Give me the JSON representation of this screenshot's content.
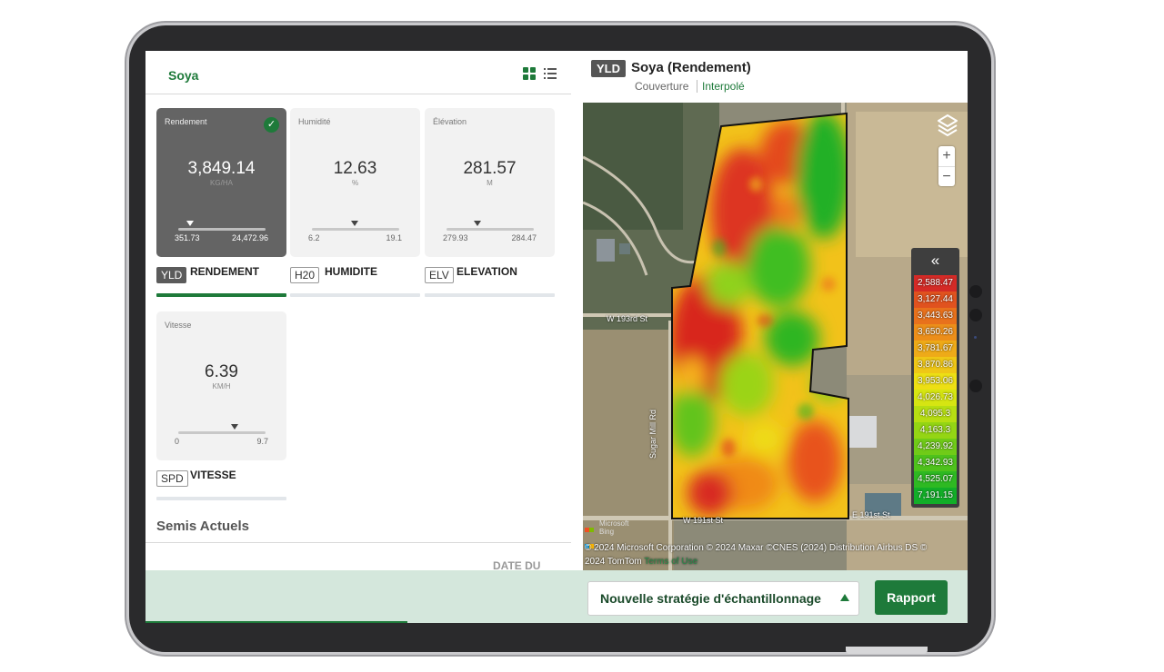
{
  "crop": "Soya",
  "cards": [
    {
      "label": "Rendement",
      "value": "3,849.14",
      "unit": "KG/HA",
      "min": "351.73",
      "max": "24,472.96",
      "code": "YLD",
      "name": "RENDEMENT",
      "selected": true
    },
    {
      "label": "Humidité",
      "value": "12.63",
      "unit": "%",
      "min": "6.2",
      "max": "19.1",
      "code": "H20",
      "name": "HUMIDITE",
      "selected": false
    },
    {
      "label": "Élévation",
      "value": "281.57",
      "unit": "M",
      "min": "279.93",
      "max": "284.47",
      "code": "ELV",
      "name": "ELEVATION",
      "selected": false
    },
    {
      "label": "Vitesse",
      "value": "6.39",
      "unit": "KM/H",
      "min": "0",
      "max": "9.7",
      "code": "SPD",
      "name": "VITESSE",
      "selected": false
    }
  ],
  "section": {
    "title": "Semis Actuels",
    "column": "DATE DU"
  },
  "map": {
    "badge": "YLD",
    "title": "Soya (Rendement)",
    "tab_coverage": "Couverture",
    "tab_interpolated": "Interpolé",
    "roads": {
      "w193": "W 193rd St",
      "e191": "E 191st St",
      "w191": "W 191st St",
      "sugar_mill": "Sugar Mill Rd"
    },
    "bing": {
      "brand": "Microsoft",
      "product": "Bing"
    },
    "credit_line1": "© 2024 Microsoft Corporation © 2024 Maxar ©CNES (2024) Distribution Airbus DS ©",
    "credit_line2": "2024 TomTom",
    "credit_terms": "Terms of Use",
    "legend_collapse": "«",
    "legend": [
      {
        "value": "2,588.47",
        "color": "#d42a26"
      },
      {
        "value": "3,127.44",
        "color": "#e0521f"
      },
      {
        "value": "3,443.63",
        "color": "#e8711c"
      },
      {
        "value": "3,650.26",
        "color": "#ec8e1a"
      },
      {
        "value": "3,781.67",
        "color": "#eeaa18"
      },
      {
        "value": "3,870.86",
        "color": "#efc716"
      },
      {
        "value": "3,953.06",
        "color": "#eddf14"
      },
      {
        "value": "4,026.73",
        "color": "#d6e512"
      },
      {
        "value": "4,095.3",
        "color": "#b6de12"
      },
      {
        "value": "4,163.3",
        "color": "#94d514"
      },
      {
        "value": "4,239.92",
        "color": "#70cb18"
      },
      {
        "value": "4,342.93",
        "color": "#4ec21c"
      },
      {
        "value": "4,525.07",
        "color": "#2eb922"
      },
      {
        "value": "7,191.15",
        "color": "#12ae28"
      }
    ]
  },
  "actions": {
    "strategy": "Nouvelle stratégie d'échantillonnage",
    "report": "Rapport"
  }
}
